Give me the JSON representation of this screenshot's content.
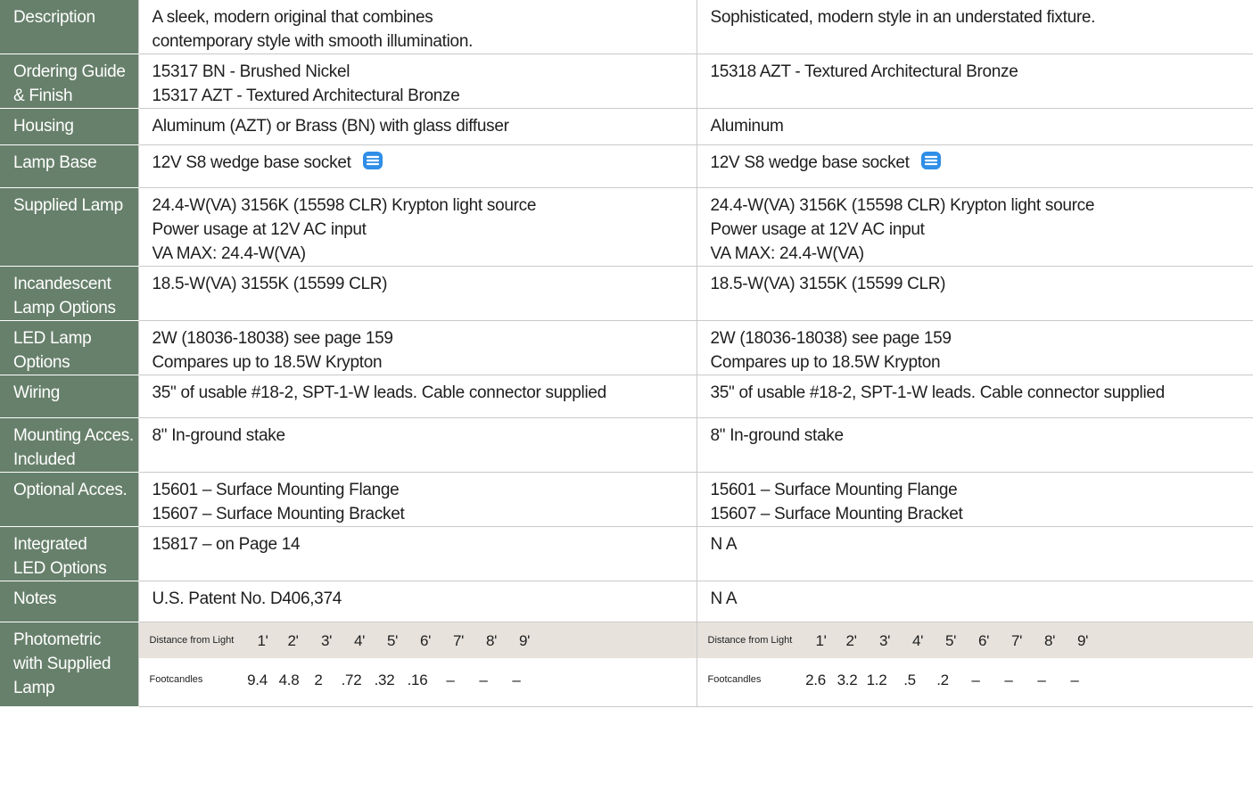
{
  "colors": {
    "label_bg": "#67806b",
    "label_text": "#ffffff",
    "photometric_band": "#e7e3dc",
    "icon_blue": "#2f8ee8"
  },
  "rows": [
    {
      "label": [
        "Description"
      ],
      "col1": [
        "A sleek, modern original that combines",
        "contemporary style with smooth illumination."
      ],
      "col2": [
        "Sophisticated, modern style in an understated fixture."
      ]
    },
    {
      "label": [
        "Ordering Guide",
        "& Finish"
      ],
      "col1": [
        "15317 BN - Brushed Nickel",
        "15317 AZT - Textured Architectural Bronze"
      ],
      "col2": [
        "15318 AZT - Textured Architectural Bronze"
      ]
    },
    {
      "label": [
        "Housing"
      ],
      "col1": [
        "Aluminum (AZT) or Brass (BN) with glass diffuser"
      ],
      "col2": [
        "Aluminum"
      ]
    },
    {
      "label": [
        "Lamp Base"
      ],
      "col1": [
        "12V  S8 wedge base socket"
      ],
      "col2": [
        "12V  S8 wedge base socket"
      ],
      "icon": "wedge-base-icon"
    },
    {
      "label": [
        "Supplied Lamp"
      ],
      "col1": [
        "24.4-W(VA) 3156K (15598 CLR) Krypton light source",
        "Power usage at 12V AC input",
        "VA MAX: 24.4-W(VA)"
      ],
      "col2": [
        "24.4-W(VA) 3156K (15598 CLR) Krypton light source",
        "Power usage at 12V AC input",
        "VA MAX: 24.4-W(VA)"
      ]
    },
    {
      "label": [
        "Incandescent",
        "Lamp Options"
      ],
      "col1": [
        "18.5-W(VA) 3155K (15599 CLR)"
      ],
      "col2": [
        "18.5-W(VA) 3155K (15599 CLR)"
      ]
    },
    {
      "label": [
        "LED Lamp",
        "Options"
      ],
      "col1": [
        "2W (18036-18038) see page 159",
        "Compares up to 18.5W Krypton"
      ],
      "col2": [
        "2W (18036-18038) see page 159",
        "Compares up to 18.5W Krypton"
      ]
    },
    {
      "label": [
        "Wiring"
      ],
      "col1": [
        "35\" of usable #18-2, SPT-1-W leads. Cable connector supplied"
      ],
      "col2": [
        "35\" of usable #18-2, SPT-1-W leads. Cable connector supplied"
      ]
    },
    {
      "label": [
        "Mounting Acces.",
        "Included"
      ],
      "col1": [
        "8\" In-ground stake"
      ],
      "col2": [
        "8\" In-ground stake"
      ]
    },
    {
      "label": [
        "Optional Acces."
      ],
      "col1": [
        "15601 – Surface Mounting Flange",
        "15607 – Surface Mounting Bracket"
      ],
      "col2": [
        "15601 – Surface Mounting Flange",
        "15607 – Surface Mounting Bracket"
      ]
    },
    {
      "label": [
        "Integrated",
        "LED Options"
      ],
      "col1": [
        "15817 – on Page 14"
      ],
      "col2": [
        "N A"
      ]
    },
    {
      "label": [
        "Notes"
      ],
      "col1": [
        "U.S. Patent No. D406,374"
      ],
      "col2": [
        "N A"
      ]
    }
  ],
  "photometric": {
    "label": [
      "Photometric",
      "with Supplied",
      "Lamp"
    ],
    "distance_label": "Distance from Light",
    "footcandles_label": "Footcandles",
    "distances": [
      "1'",
      "2'",
      "3'",
      "4'",
      "5'",
      "6'",
      "7'",
      "8'",
      "9'"
    ],
    "col1_footcandles": [
      "9.4",
      "4.8",
      "2",
      ".72",
      ".32",
      ".16",
      "–",
      "–",
      "–"
    ],
    "col2_footcandles": [
      "2.6",
      "3.2",
      "1.2",
      ".5",
      ".2",
      "–",
      "–",
      "–",
      "–"
    ]
  }
}
